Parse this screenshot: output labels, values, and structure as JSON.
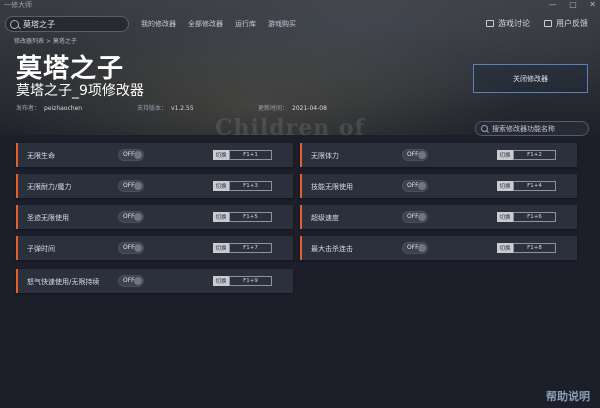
{
  "window": {
    "app_name": "一修大师",
    "minimize": "—",
    "maximize": "□",
    "close": "✕"
  },
  "search": {
    "value": "莫塔之子",
    "placeholder": "莫塔之子"
  },
  "nav": {
    "items": [
      "我的修改器",
      "全部修改器",
      "运行库",
      "游戏购买"
    ]
  },
  "right_links": {
    "discuss": "游戏讨论",
    "feedback": "用户反馈"
  },
  "breadcrumb": "修改器列表 > 莫塔之子",
  "hero_watermark": "Children of",
  "game": {
    "title": "莫塔之子",
    "subtitle": "莫塔之子_9项修改器",
    "publisher_label": "发布者：",
    "publisher": "peizhaochen",
    "version_label": "支持版本：",
    "version": "v1.2.55",
    "updated_label": "更新时间：",
    "updated": "2021-04-08"
  },
  "close_button": "关闭修改器",
  "feature_search": {
    "placeholder": "搜索修改器功能名称"
  },
  "toggle_label": "OFF",
  "hotkey_tag": "切换",
  "features": [
    {
      "label": "无限生命",
      "key": "F1+1"
    },
    {
      "label": "无限体力",
      "key": "F1+2"
    },
    {
      "label": "无限耐力/魔力",
      "key": "F1+3"
    },
    {
      "label": "技能无限使用",
      "key": "F1+4"
    },
    {
      "label": "圣迹无限使用",
      "key": "F1+5"
    },
    {
      "label": "超级速度",
      "key": "F1+6"
    },
    {
      "label": "子弹时间",
      "key": "F1+7"
    },
    {
      "label": "最大击杀连击",
      "key": "F1+8"
    },
    {
      "label": "怒气快速使用/无限持续",
      "key": "F1+9"
    }
  ],
  "help": "帮助说明",
  "colors": {
    "accent": "#e0612f",
    "button_border": "#5d7fbc",
    "background": "#1c1f2a"
  }
}
